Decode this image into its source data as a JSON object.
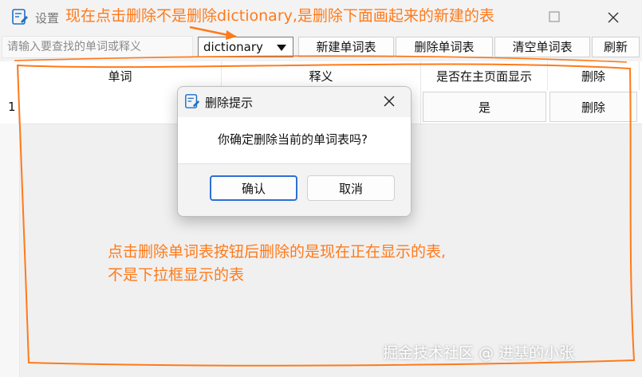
{
  "window": {
    "title": "设置",
    "icon": "notepad-icon"
  },
  "toolbar": {
    "search_placeholder": "请输入要查找的单词或释义",
    "search_value": "",
    "select_value": "dictionary",
    "buttons": [
      "新建单词表",
      "删除单词表",
      "清空单词表",
      "刷新"
    ]
  },
  "table": {
    "headers": [
      "单词",
      "释义",
      "是否在主页面显示",
      "删除"
    ],
    "rows": [
      {
        "index": "1",
        "word": "",
        "definition": "",
        "show_on_main": "是",
        "delete": "删除"
      }
    ]
  },
  "dialog": {
    "title": "删除提示",
    "message": "你确定删除当前的单词表吗?",
    "confirm_label": "确认",
    "cancel_label": "取消"
  },
  "annotations": {
    "top_note": "现在点击删除不是删除dictionary,是删除下面画起来的新建的表",
    "middle_note_line1": "点击删除单词表按钮后删除的是现在正在显示的表,",
    "middle_note_line2": "不是下拉框显示的表",
    "color": "#ff7a1a"
  },
  "watermark": "掘金技术社区 @ 进基的小张",
  "colors": {
    "annotation": "#ff7a1a",
    "dialog_primary_border": "#2f6fd6"
  }
}
